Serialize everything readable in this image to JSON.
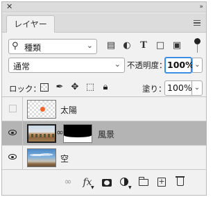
{
  "window": {
    "close_glyph": "✕",
    "collapse_glyph": "»"
  },
  "tabs": [
    {
      "label": "レイヤー"
    }
  ],
  "filter": {
    "kind_label": "種類",
    "icons": [
      "image-filter-icon",
      "adjustment-filter-icon",
      "type-filter-icon",
      "shape-filter-icon",
      "smart-object-filter-icon"
    ]
  },
  "blend": {
    "mode": "通常",
    "opacity_label": "不透明度：",
    "opacity_value": "100%"
  },
  "lock": {
    "label": "ロック：",
    "icons": [
      "lock-transparent-pixels-icon",
      "lock-image-pixels-icon",
      "lock-position-icon",
      "lock-artboard-icon",
      "lock-all-icon"
    ],
    "fill_label": "塗り：",
    "fill_value": "100%"
  },
  "layers": [
    {
      "name": "太陽",
      "visible": false,
      "thumb": "sun",
      "selected": false
    },
    {
      "name": "風景",
      "visible": true,
      "thumb": "landscape",
      "has_mask": true,
      "selected": true
    },
    {
      "name": "空",
      "visible": true,
      "thumb": "sky",
      "selected": false
    }
  ],
  "footer": {
    "fx_label": "fx",
    "icons": [
      "link-layers-icon",
      "layer-style-icon",
      "add-mask-icon",
      "adjustment-layer-icon",
      "new-group-icon",
      "new-layer-icon",
      "delete-layer-icon"
    ]
  }
}
